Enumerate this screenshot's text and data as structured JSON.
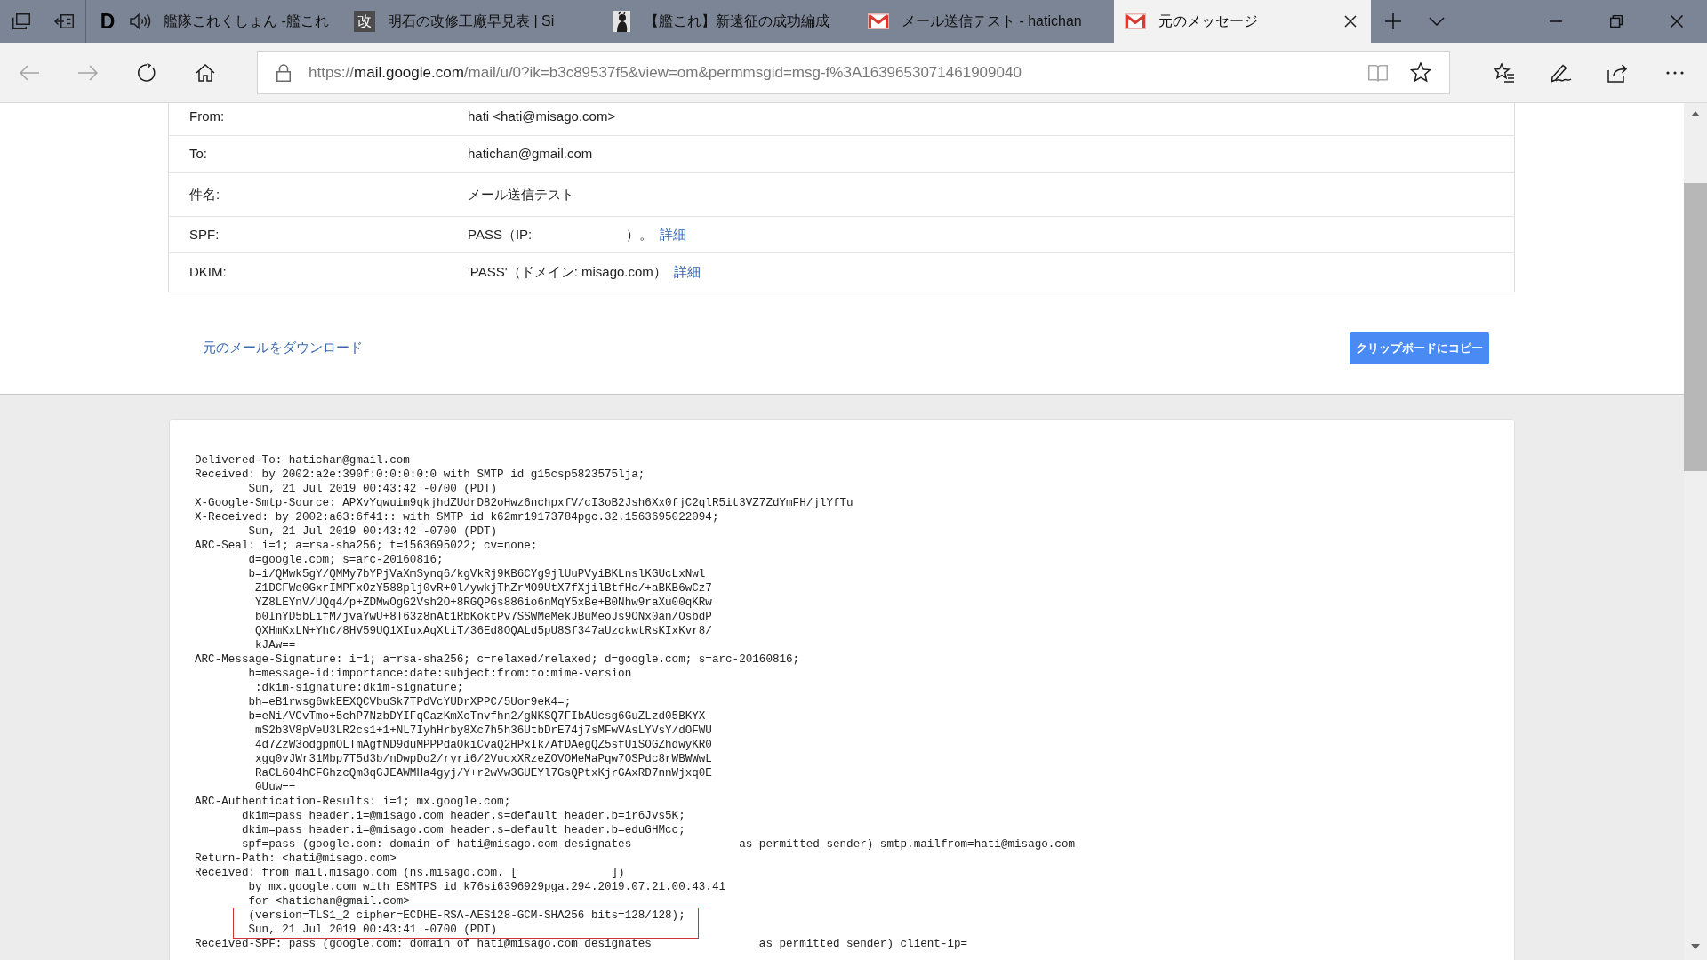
{
  "browser": {
    "tabs": [
      {
        "title": "艦隊これくしょん -艦これ",
        "favicon": {
          "kind": "letter",
          "text": "D"
        },
        "audio": true,
        "selected": false
      },
      {
        "title": "明石の改修工廠早見表 | Si",
        "favicon": {
          "kind": "tile",
          "text": "改"
        },
        "audio": false,
        "selected": false
      },
      {
        "title": "【艦これ】新遠征の成功編成",
        "favicon": {
          "kind": "image"
        },
        "audio": false,
        "selected": false
      },
      {
        "title": "メール送信テスト - hatichan",
        "favicon": {
          "kind": "mail"
        },
        "audio": false,
        "selected": false
      },
      {
        "title": "元のメッセージ",
        "favicon": {
          "kind": "mail"
        },
        "audio": false,
        "selected": true
      }
    ],
    "navigation": [
      {
        "kind": "back",
        "disabled": true
      },
      {
        "kind": "forward",
        "disabled": true
      },
      {
        "kind": "refresh",
        "disabled": false
      },
      {
        "kind": "home",
        "disabled": false
      }
    ],
    "url": {
      "scheme": "https://",
      "host": "mail.google.com",
      "path": "/mail/u/0?ik=b3c89537f5&view=om&permmsgid=msg-f%3A1639653071461909040"
    }
  },
  "headers": [
    {
      "label": "From:",
      "parts": [
        "hati <hati@misago.com>"
      ]
    },
    {
      "label": "To:",
      "parts": [
        "hatichan@gmail.com"
      ]
    },
    {
      "label": "件名:",
      "parts": [
        "メール送信テスト"
      ]
    },
    {
      "label": "SPF:",
      "parts": [
        "PASS（IP:",
        "）。"
      ],
      "link": "詳細"
    },
    {
      "label": "DKIM:",
      "parts": [
        "'PASS'（ドメイン: misago.com）"
      ],
      "link": "詳細"
    }
  ],
  "download_link": "元のメールをダウンロード",
  "copy_button": "クリップボードにコピー",
  "raw_message": {
    "blocks": [
      {
        "highlighted": false,
        "lines": [
          "Delivered-To: hatichan@gmail.com",
          "Received: by 2002:a2e:390f:0:0:0:0:0 with SMTP id g15csp5823575lja;",
          "        Sun, 21 Jul 2019 00:43:42 -0700 (PDT)",
          "X-Google-Smtp-Source: APXvYqwuim9qkjhdZUdrD82oHwz6nchpxfV/cI3oB2Jsh6Xx0fjC2qlR5it3VZ7ZdYmFH/jlYfTu",
          "X-Received: by 2002:a63:6f41:: with SMTP id k62mr19173784pgc.32.1563695022094;",
          "        Sun, 21 Jul 2019 00:43:42 -0700 (PDT)",
          "ARC-Seal: i=1; a=rsa-sha256; t=1563695022; cv=none;",
          "        d=google.com; s=arc-20160816;",
          "        b=i/QMwk5gY/QMMy7bYPjVaXmSynq6/kgVkRj9KB6CYg9jlUuPVyiBKLnslKGUcLxNwl",
          "         Z1DCFWe0GxrIMPFxOzY588plj0vR+0l/ywkjThZrMO9UtX7fXjilBtfHc/+aBKB6wCz7",
          "         YZ8LEYnV/UQq4/p+ZDMwOgG2Vsh2O+8RGQPGs886io6nMqY5xBe+B0Nhw9raXu00qKRw",
          "         b0InYD5bLifM/jvaYwU+8T63z8nAt1RbKoktPv7SSWMeMekJBuMeoJs9ONx0an/OsbdP",
          "         QXHmKxLN+YhC/8HV59UQ1XIuxAqXtiT/36Ed8OQALd5pU8Sf347aUzckwtRsKIxKvr8/",
          "         kJAw==",
          "ARC-Message-Signature: i=1; a=rsa-sha256; c=relaxed/relaxed; d=google.com; s=arc-20160816;",
          "        h=message-id:importance:date:subject:from:to:mime-version",
          "         :dkim-signature:dkim-signature;",
          "        bh=eB1rwsg6wkEEXQCVbuSk7TPdVcYUDrXPPC/5Uor9eK4=;",
          "        b=eNi/VCvTmo+5chP7NzbDYIFqCazKmXcTnvfhn2/gNKSQ7FIbAUcsg6GuZLzd05BKYX",
          "         mS2b3V8pVeU3LR2cs1+1+NL7IyhHrby8Xc7h5h36UtbDrE74j7sMFwVAsLYVsY/dOFWU",
          "         4d7ZzW3odgpmOLTmAgfND9duMPPPdaOkiCvaQ2HPxIk/AfDAegQZ5sfUiSOGZhdwyKR0",
          "         xgq0vJWr31Mbp7T5d3b/nDwpDo2/ryri6/2VucxXRzeZOVOMeMaPqw7OSPdc8rWBWWwL",
          "         RaCL6O4hCFGhzcQm3qGJEAWMHa4gyj/Y+r2wVw3GUEYl7GsQPtxKjrGAxRD7nnWjxq0E",
          "         0Uuw==",
          "ARC-Authentication-Results: i=1; mx.google.com;",
          "       dkim=pass header.i=@misago.com header.s=default header.b=ir6Jvs5K;",
          "       dkim=pass header.i=@misago.com header.s=default header.b=eduGHMcc;",
          "       spf=pass (google.com: domain of hati@misago.com designates                as permitted sender) smtp.mailfrom=hati@misago.com",
          "Return-Path: <hati@misago.com>",
          "Received: from mail.misago.com (ns.misago.com. [              ])",
          "        by mx.google.com with ESMTPS id k76si6396929pga.294.2019.07.21.00.43.41",
          "        for <hatichan@gmail.com>"
        ]
      },
      {
        "highlighted": true,
        "lines": [
          "        (version=TLS1_2 cipher=ECDHE-RSA-AES128-GCM-SHA256 bits=128/128);",
          "        Sun, 21 Jul 2019 00:43:41 -0700 (PDT)"
        ]
      },
      {
        "highlighted": false,
        "lines": [
          "Received-SPF: pass (google.com: domain of hati@misago.com designates                as permitted sender) client-ip="
        ]
      }
    ]
  }
}
